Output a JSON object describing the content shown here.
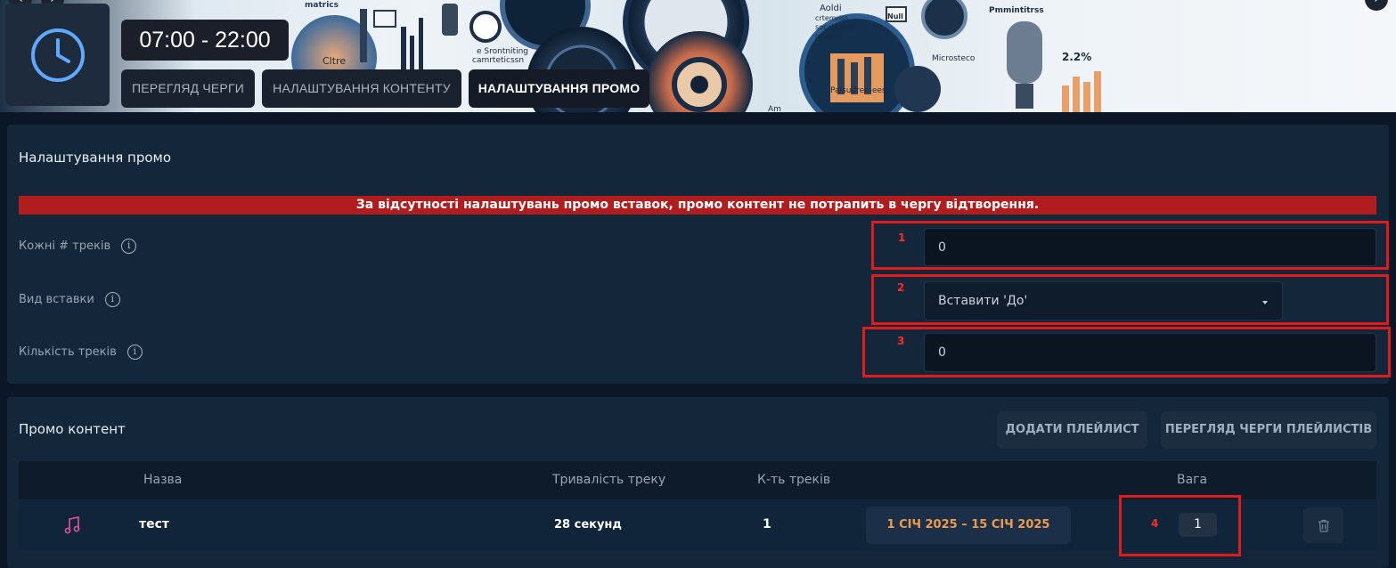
{
  "header": {
    "time_range": "07:00 - 22:00",
    "tabs": [
      {
        "label": "ПЕРЕГЛЯД ЧЕРГИ",
        "active": false
      },
      {
        "label": "НАЛАШТУВАННЯ КОНТЕНТУ",
        "active": false
      },
      {
        "label": "НАЛАШТУВАННЯ ПРОМО",
        "active": true
      }
    ],
    "icons": {
      "clock": "clock-icon",
      "prev": "chevron-left-icon",
      "next": "chevron-right-icon"
    },
    "banner_texts": [
      "matrics",
      "Aoldi",
      "crtemriss",
      "socahtionip",
      "pearrtes",
      "Null",
      "Microsteco",
      "Pmmintitrss",
      "2.2%",
      "Cltre",
      "e Srontniting",
      "camrteticssn",
      "Palsudree-eeso",
      "Am"
    ]
  },
  "promo_settings": {
    "title": "Налаштування промо",
    "warning": "За відсутності налаштувань промо вставок, промо контент не потрапить в чергу відтворення.",
    "fields": [
      {
        "label": "Кожні # треків",
        "value": "0",
        "marker": "1"
      },
      {
        "label": "Вид вставки",
        "value": "Вставити 'До'",
        "marker": "2"
      },
      {
        "label": "Кількість треків",
        "value": "0",
        "marker": "3"
      }
    ],
    "info_glyph": "i"
  },
  "promo_content": {
    "title": "Промо контент",
    "add_playlist_label": "ДОДАТИ ПЛЕЙЛИСТ",
    "view_queue_label": "ПЕРЕГЛЯД ЧЕРГИ ПЛЕЙЛИСТІВ",
    "columns": [
      "Назва",
      "Тривалість треку",
      "К-ть треків",
      "Вага"
    ],
    "rows": [
      {
        "icon": "music-note-icon",
        "name": "тест",
        "duration": "28 секунд",
        "count": "1",
        "dates": "1 СІЧ 2025 – 15 СІЧ 2025",
        "weight": "1",
        "marker": "4"
      }
    ]
  },
  "colors": {
    "accent_red": "#e01b1b",
    "warning_bg": "#b11c1e",
    "date_orange": "#ef9c4a",
    "music_pink": "#e0559a"
  }
}
